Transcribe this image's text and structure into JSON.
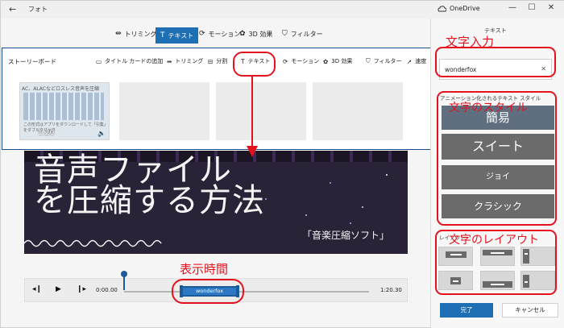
{
  "titlebar": {
    "back": "←",
    "title": "フォト",
    "onedrive": "OneDrive",
    "min": "—",
    "max": "☐",
    "close": "✕"
  },
  "editor_toolbar": [
    {
      "icon": "⇹",
      "label": "トリミング"
    },
    {
      "icon": "T",
      "label": "テキスト"
    },
    {
      "icon": "⟳",
      "label": "モーション"
    },
    {
      "icon": "✿",
      "label": "3D 効果"
    },
    {
      "icon": "⛉",
      "label": "フィルター"
    }
  ],
  "storyboard": {
    "title": "ストーリーボード",
    "tools": [
      {
        "icon": "▭",
        "label": "タイトル カードの追加"
      },
      {
        "icon": "⇹",
        "label": "トリミング"
      },
      {
        "icon": "⊟",
        "label": "分割"
      },
      {
        "icon": "T",
        "label": "テキスト"
      },
      {
        "icon": "⟳",
        "label": "モーション"
      },
      {
        "icon": "✿",
        "label": "3D 効果"
      },
      {
        "icon": "⛉",
        "label": "フィルター"
      },
      {
        "icon": "➚",
        "label": "速度"
      }
    ],
    "clip": {
      "caption": "AC、ALACなどロスレス音声を圧縮",
      "duration": "1:20",
      "sub": "この形式はアプリをダウンロードして「引集」をダブルクリック"
    }
  },
  "preview": {
    "line1": "音声ファイル",
    "line2": "を圧縮する方法",
    "line3": "「音楽圧縮ソフト」"
  },
  "playback": {
    "start": "0:00.00",
    "end": "1:20.30",
    "clip_label": "wonderfox",
    "progress": 0.0
  },
  "panel": {
    "header": "テキスト",
    "text_value": "wonderfox",
    "style_label": "アニメーション化されるテキスト スタイル",
    "styles": [
      "簡易",
      "スイート",
      "ジョイ",
      "クラシック"
    ],
    "layout_label": "レイアウト",
    "done": "完了",
    "cancel": "キャンセル"
  },
  "annotations": {
    "text_input": "文字入力",
    "text_style": "文字のスタイル",
    "text_layout": "文字のレイアウト",
    "display_time": "表示時間",
    "color": "#e3121d"
  },
  "accent_color": "#1f6fb5"
}
